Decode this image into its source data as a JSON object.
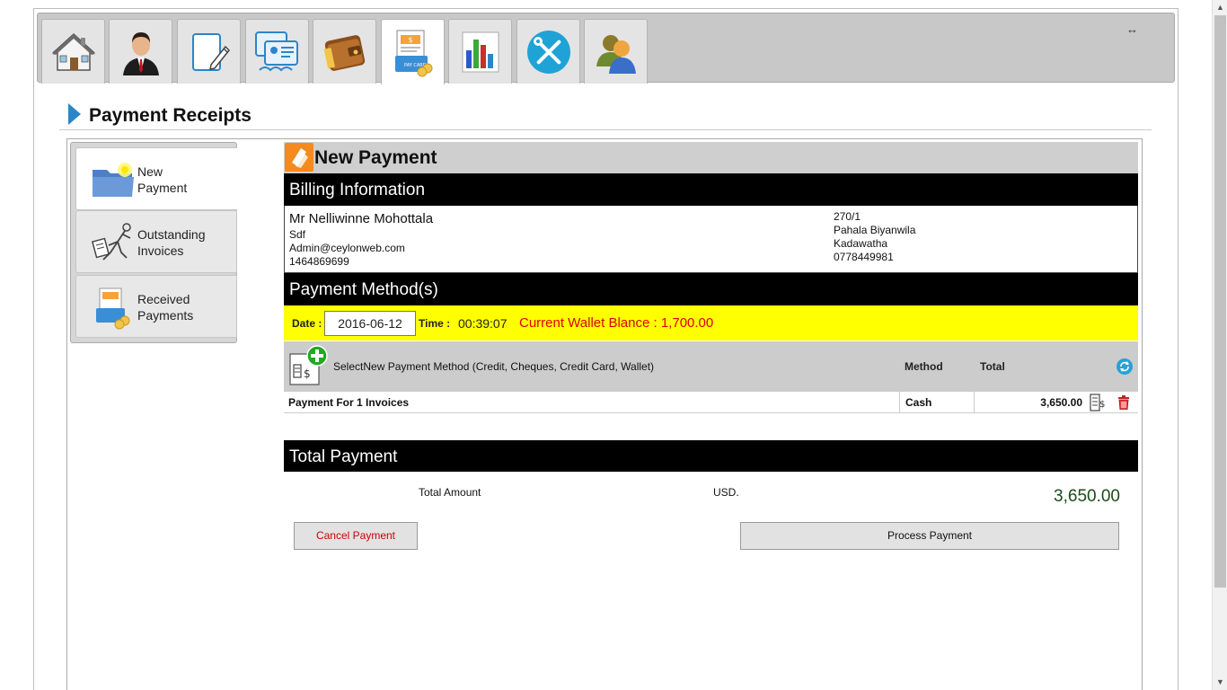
{
  "tabs": [
    {
      "name": "home",
      "icon": "house-icon",
      "active": false
    },
    {
      "name": "user",
      "icon": "businessman-icon",
      "active": false
    },
    {
      "name": "edit",
      "icon": "edit-document-icon",
      "active": false
    },
    {
      "name": "cards",
      "icon": "id-cards-icon",
      "active": false
    },
    {
      "name": "wallet",
      "icon": "wallet-icon",
      "active": false
    },
    {
      "name": "payments",
      "icon": "pay-card-icon",
      "active": true
    },
    {
      "name": "reports",
      "icon": "bar-chart-icon",
      "active": false
    },
    {
      "name": "tools",
      "icon": "tools-icon",
      "active": false
    },
    {
      "name": "users",
      "icon": "users-group-icon",
      "active": false
    }
  ],
  "page": {
    "title": "Payment Receipts"
  },
  "sidebar": {
    "items": [
      {
        "label_line1": "New",
        "label_line2": "Payment",
        "icon": "folder-star-icon",
        "active": true
      },
      {
        "label_line1": "Outstanding",
        "label_line2": "Invoices",
        "icon": "running-man-icon",
        "active": false
      },
      {
        "label_line1": "Received",
        "label_line2": "Payments",
        "icon": "received-card-icon",
        "active": false
      }
    ]
  },
  "panel": {
    "title": "New Payment",
    "billing_heading": "Billing Information",
    "customer": {
      "name": "Mr Nelliwinne Mohottala",
      "company": "Sdf",
      "email": "Admin@ceylonweb.com",
      "phone": "1464869699"
    },
    "address": {
      "line1": "270/1",
      "line2": "Pahala Biyanwila",
      "line3": "Kadawatha",
      "phone": "0778449981"
    },
    "methods_heading": "Payment Method(s)",
    "date_label": "Date :",
    "date_value": "2016-06-12",
    "time_label": "Time :",
    "time_value": "00:39:07",
    "wallet_text": "Current Wallet Blance : 1,700.00",
    "select_method_text": "SelectNew Payment Method (Credit, Cheques, Credit Card, Wallet)",
    "col_method": "Method",
    "col_total": "Total",
    "rows": [
      {
        "description": "Payment For 1 Invoices",
        "method": "Cash",
        "total": "3,650.00"
      }
    ],
    "total_heading": "Total Payment",
    "total_label": "Total Amount",
    "currency": "USD.",
    "total_value": "3,650.00",
    "cancel_label": "Cancel Payment",
    "process_label": "Process Payment"
  },
  "colors": {
    "accent_blue": "#2a86c8",
    "wallet_red": "#e00000",
    "highlight_yellow": "#ffff00",
    "badge_orange": "#f58a1f"
  }
}
